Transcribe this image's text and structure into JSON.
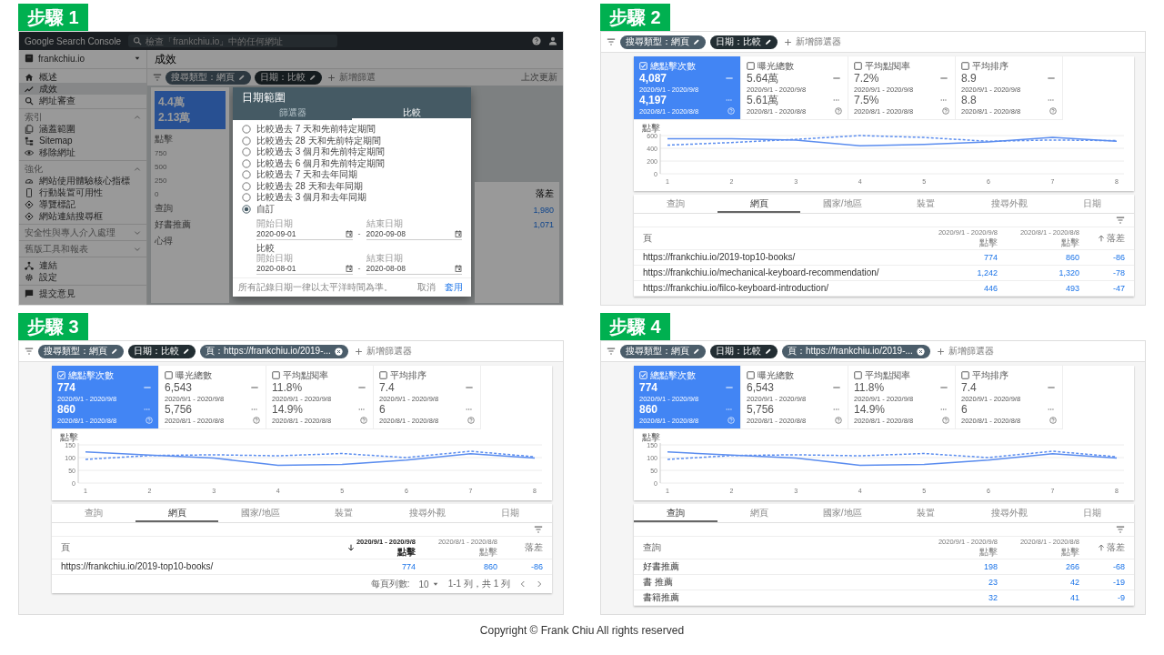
{
  "steps": [
    {
      "label": "步驟 1",
      "kind": "dialog",
      "app_bar": {
        "product": "Google Search Console",
        "search_placeholder": "檢查「frankchiu.io」中的任何網址"
      },
      "sidebar": {
        "property": "frankchiu.io",
        "items": [
          {
            "label": "概述",
            "selected": false
          },
          {
            "label": "成效",
            "selected": true
          },
          {
            "label": "網址審查",
            "selected": false
          }
        ],
        "groups": [
          {
            "title": "索引",
            "expanded": true,
            "children": [
              {
                "label": "涵蓋範圍"
              },
              {
                "label": "Sitemap"
              },
              {
                "label": "移除網址"
              }
            ]
          },
          {
            "title": "強化",
            "expanded": true,
            "children": [
              {
                "label": "網站使用體驗核心指標"
              },
              {
                "label": "行動裝置可用性"
              },
              {
                "label": "導覽標記"
              },
              {
                "label": "網站連結搜尋框"
              }
            ]
          },
          {
            "title": "安全性與專人介入處理",
            "expanded": false
          },
          {
            "title": "舊版工具和報表",
            "expanded": false
          }
        ],
        "bottom": [
          {
            "label": "連結"
          },
          {
            "label": "設定"
          }
        ],
        "feedback": "提交意見"
      },
      "page_title": "成效",
      "filters": [
        {
          "text": "搜尋類型：網頁",
          "removable": false,
          "color": "#4b5d6a"
        },
        {
          "text": "日期：比較",
          "removable": false,
          "color": "#232e33"
        }
      ],
      "add_filter": "新增篩選",
      "last_updated": "上次更新",
      "background": {
        "metric_values": [
          "4.4萬",
          "2.13萬"
        ],
        "chart_label": "點擊",
        "y_ticks": [
          "750",
          "500",
          "250",
          "0"
        ],
        "table_header": "查詢",
        "row_labels": [
          "好書推薦",
          "心得"
        ],
        "right_header": "落差",
        "right_values": [
          "1,980",
          "1,071"
        ]
      },
      "dialog": {
        "title": "日期範圍",
        "tabs": [
          {
            "label": "篩選器",
            "selected": false
          },
          {
            "label": "比較",
            "selected": true
          }
        ],
        "options": [
          {
            "label": "比較過去 7 天和先前特定期間",
            "selected": false
          },
          {
            "label": "比較過去 28 天和先前特定期間",
            "selected": false
          },
          {
            "label": "比較過去 3 個月和先前特定期間",
            "selected": false
          },
          {
            "label": "比較過去 6 個月和先前特定期間",
            "selected": false
          },
          {
            "label": "比較過去 7 天和去年同期",
            "selected": false
          },
          {
            "label": "比較過去 28 天和去年同期",
            "selected": false
          },
          {
            "label": "比較過去 3 個月和去年同期",
            "selected": false
          },
          {
            "label": "自訂",
            "selected": true
          }
        ],
        "ranges": [
          {
            "start_label": "開始日期",
            "start": "2020-09-01",
            "separator": "-",
            "end_label": "結束日期",
            "end": "2020-09-08"
          },
          {
            "title": "比較",
            "start_label": "開始日期",
            "start": "2020-08-01",
            "separator": "-",
            "end_label": "結束日期",
            "end": "2020-08-08"
          }
        ],
        "note": "所有記錄日期一律以太平洋時間為準。",
        "cancel": "取消",
        "apply": "套用"
      }
    },
    {
      "label": "步驟 2",
      "kind": "report",
      "filters": [
        {
          "text": "搜尋類型：網頁",
          "removable": false,
          "color": "#4b5d6a"
        },
        {
          "text": "日期：比較",
          "removable": false,
          "color": "#232e33"
        }
      ],
      "add_filter": "新增篩選器",
      "metrics": [
        {
          "label": "總點擊次數",
          "checked": true,
          "current": "4,087",
          "current_range": "2020/9/1 - 2020/9/8",
          "previous": "4,197",
          "previous_range": "2020/8/1 - 2020/8/8"
        },
        {
          "label": "曝光總數",
          "checked": false,
          "current": "5.64萬",
          "current_range": "2020/9/1 - 2020/9/8",
          "previous": "5.61萬",
          "previous_range": "2020/8/1 - 2020/8/8"
        },
        {
          "label": "平均點閱率",
          "checked": false,
          "current": "7.2%",
          "current_range": "2020/9/1 - 2020/9/8",
          "previous": "7.5%",
          "previous_range": "2020/8/1 - 2020/8/8"
        },
        {
          "label": "平均排序",
          "checked": false,
          "current": "8.9",
          "current_range": "2020/9/1 - 2020/9/8",
          "previous": "8.8",
          "previous_range": "2020/8/1 - 2020/8/8"
        }
      ],
      "chart_data": {
        "type": "line",
        "ylabel": "點擊",
        "x": [
          1,
          2,
          3,
          4,
          5,
          6,
          7,
          8
        ],
        "ylim": [
          0,
          600
        ],
        "yticks": [
          0,
          200,
          400,
          600
        ],
        "series": [
          {
            "color": "#5b8def",
            "line_style": "solid",
            "values": [
              550,
              550,
              530,
              440,
              460,
              500,
              570,
              510
            ]
          },
          {
            "color": "#5b8def",
            "line_style": "dashed",
            "values": [
              450,
              490,
              540,
              600,
              570,
              510,
              530,
              520
            ]
          }
        ]
      },
      "tabs": [
        {
          "label": "查詢",
          "selected": false
        },
        {
          "label": "網頁",
          "selected": true
        },
        {
          "label": "國家/地區",
          "selected": false
        },
        {
          "label": "裝置",
          "selected": false
        },
        {
          "label": "搜尋外觀",
          "selected": false
        },
        {
          "label": "日期",
          "selected": false
        }
      ],
      "table": {
        "columns": [
          {
            "label": "頁",
            "sorted": false
          },
          {
            "range": "2020/9/1 - 2020/9/8",
            "label": "點擊",
            "sorted": false
          },
          {
            "range": "2020/8/1 - 2020/8/8",
            "label": "點擊",
            "sorted": false
          },
          {
            "label": "落差",
            "sorted": true,
            "descending": false
          }
        ],
        "rows": [
          {
            "cells": [
              "https://frankchiu.io/2019-top10-books/",
              "774",
              "860",
              "-86"
            ]
          },
          {
            "cells": [
              "https://frankchiu.io/mechanical-keyboard-recommendation/",
              "1,242",
              "1,320",
              "-78"
            ]
          },
          {
            "cells": [
              "https://frankchiu.io/filco-keyboard-introduction/",
              "446",
              "493",
              "-47"
            ]
          }
        ]
      }
    },
    {
      "label": "步驟 3",
      "kind": "report",
      "filters": [
        {
          "text": "搜尋類型：網頁",
          "removable": false,
          "color": "#4b5d6a"
        },
        {
          "text": "日期：比較",
          "removable": false,
          "color": "#232e33"
        },
        {
          "text": "頁：https://frankchiu.io/2019-...",
          "removable": true,
          "color": "#4b5d6a"
        }
      ],
      "add_filter": "新增篩選器",
      "metrics": [
        {
          "label": "總點擊次數",
          "checked": true,
          "current": "774",
          "current_range": "2020/9/1 - 2020/9/8",
          "previous": "860",
          "previous_range": "2020/8/1 - 2020/8/8"
        },
        {
          "label": "曝光總數",
          "checked": false,
          "current": "6,543",
          "current_range": "2020/9/1 - 2020/9/8",
          "previous": "5,756",
          "previous_range": "2020/8/1 - 2020/8/8"
        },
        {
          "label": "平均點閱率",
          "checked": false,
          "current": "11.8%",
          "current_range": "2020/9/1 - 2020/9/8",
          "previous": "14.9%",
          "previous_range": "2020/8/1 - 2020/8/8"
        },
        {
          "label": "平均排序",
          "checked": false,
          "current": "7.4",
          "current_range": "2020/9/1 - 2020/9/8",
          "previous": "6",
          "previous_range": "2020/8/1 - 2020/8/8"
        }
      ],
      "chart_data": {
        "type": "line",
        "ylabel": "點擊",
        "x": [
          1,
          2,
          3,
          4,
          5,
          6,
          7,
          8
        ],
        "ylim": [
          0,
          150
        ],
        "yticks": [
          0,
          50,
          100,
          150
        ],
        "series": [
          {
            "color": "#5b8def",
            "line_style": "solid",
            "values": [
              122,
              110,
              98,
              70,
              73,
              90,
              115,
              98
            ]
          },
          {
            "color": "#5b8def",
            "line_style": "dashed",
            "values": [
              93,
              108,
              111,
              107,
              116,
              100,
              125,
              103
            ]
          }
        ]
      },
      "tabs": [
        {
          "label": "查詢",
          "selected": false
        },
        {
          "label": "網頁",
          "selected": true
        },
        {
          "label": "國家/地區",
          "selected": false
        },
        {
          "label": "裝置",
          "selected": false
        },
        {
          "label": "搜尋外觀",
          "selected": false
        },
        {
          "label": "日期",
          "selected": false
        }
      ],
      "table": {
        "columns": [
          {
            "label": "頁",
            "sorted": false
          },
          {
            "range": "2020/9/1 - 2020/9/8",
            "label": "點擊",
            "sorted": true,
            "descending": true
          },
          {
            "range": "2020/8/1 - 2020/8/8",
            "label": "點擊",
            "sorted": false
          },
          {
            "label": "落差",
            "sorted": false
          }
        ],
        "rows": [
          {
            "cells": [
              "https://frankchiu.io/2019-top10-books/",
              "774",
              "860",
              "-86"
            ]
          }
        ]
      },
      "pagination": {
        "rows_label": "每頁列數:",
        "rows_per_page": "10",
        "range": "1-1 列，共 1 列"
      }
    },
    {
      "label": "步驟 4",
      "kind": "report",
      "filters": [
        {
          "text": "搜尋類型：網頁",
          "removable": false,
          "color": "#4b5d6a"
        },
        {
          "text": "日期：比較",
          "removable": false,
          "color": "#232e33"
        },
        {
          "text": "頁：https://frankchiu.io/2019-...",
          "removable": true,
          "color": "#4b5d6a"
        }
      ],
      "add_filter": "新增篩選器",
      "metrics": [
        {
          "label": "總點擊次數",
          "checked": true,
          "current": "774",
          "current_range": "2020/9/1 - 2020/9/8",
          "previous": "860",
          "previous_range": "2020/8/1 - 2020/8/8"
        },
        {
          "label": "曝光總數",
          "checked": false,
          "current": "6,543",
          "current_range": "2020/9/1 - 2020/9/8",
          "previous": "5,756",
          "previous_range": "2020/8/1 - 2020/8/8"
        },
        {
          "label": "平均點閱率",
          "checked": false,
          "current": "11.8%",
          "current_range": "2020/9/1 - 2020/9/8",
          "previous": "14.9%",
          "previous_range": "2020/8/1 - 2020/8/8"
        },
        {
          "label": "平均排序",
          "checked": false,
          "current": "7.4",
          "current_range": "2020/9/1 - 2020/9/8",
          "previous": "6",
          "previous_range": "2020/8/1 - 2020/8/8"
        }
      ],
      "chart_data": {
        "type": "line",
        "ylabel": "點擊",
        "x": [
          1,
          2,
          3,
          4,
          5,
          6,
          7,
          8
        ],
        "ylim": [
          0,
          150
        ],
        "yticks": [
          0,
          50,
          100,
          150
        ],
        "series": [
          {
            "color": "#5b8def",
            "line_style": "solid",
            "values": [
              122,
              110,
              98,
              70,
              73,
              90,
              115,
              98
            ]
          },
          {
            "color": "#5b8def",
            "line_style": "dashed",
            "values": [
              93,
              108,
              111,
              107,
              116,
              100,
              125,
              103
            ]
          }
        ]
      },
      "tabs": [
        {
          "label": "查詢",
          "selected": true
        },
        {
          "label": "網頁",
          "selected": false
        },
        {
          "label": "國家/地區",
          "selected": false
        },
        {
          "label": "裝置",
          "selected": false
        },
        {
          "label": "搜尋外觀",
          "selected": false
        },
        {
          "label": "日期",
          "selected": false
        }
      ],
      "table": {
        "columns": [
          {
            "label": "查詢",
            "sorted": false
          },
          {
            "range": "2020/9/1 - 2020/9/8",
            "label": "點擊",
            "sorted": false
          },
          {
            "range": "2020/8/1 - 2020/8/8",
            "label": "點擊",
            "sorted": false
          },
          {
            "label": "落差",
            "sorted": true,
            "descending": false
          }
        ],
        "rows": [
          {
            "cells": [
              "好書推薦",
              "198",
              "266",
              "-68"
            ]
          },
          {
            "cells": [
              "書 推薦",
              "23",
              "42",
              "-19"
            ]
          },
          {
            "cells": [
              "書籍推薦",
              "32",
              "41",
              "-9"
            ]
          }
        ]
      }
    }
  ],
  "footer": "Copyright © Frank Chiu All rights reserved"
}
